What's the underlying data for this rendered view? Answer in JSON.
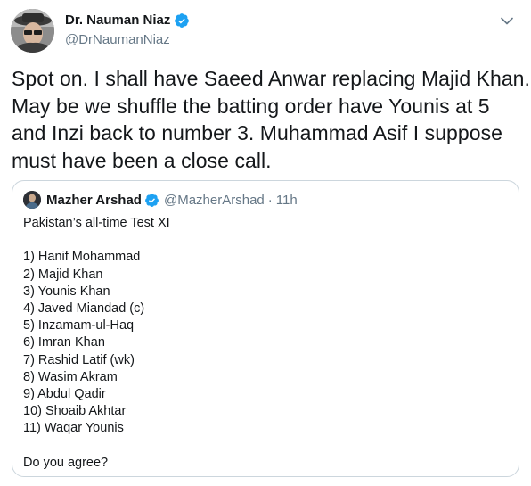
{
  "author": {
    "display_name": "Dr. Nauman Niaz",
    "handle": "@DrNaumanNiaz",
    "verified": true,
    "avatar_icon": "avatar-photo-icon"
  },
  "tweet": {
    "lines": [
      "Spot on. I shall have Saeed Anwar replacing Majid Khan.",
      "May be we shuffle the batting order have Younis at 5",
      "and Inzi back to number 3. Muhammad Asif I suppose",
      "must have been a close call."
    ]
  },
  "quoted": {
    "display_name": "Mazher Arshad",
    "handle": "@MazherArshad",
    "separator": "·",
    "time": "11h",
    "verified": true,
    "intro": "Pakistan’s all-time Test XI",
    "list": [
      "1) Hanif Mohammad",
      "2) Majid Khan",
      "3) Younis Khan",
      "4) Javed Miandad (c)",
      "5) Inzamam-ul-Haq",
      "6) Imran Khan",
      "7) Rashid Latif (wk)",
      "8) Wasim Akram",
      "9) Abdul Qadir",
      "10) Shoaib Akhtar",
      "11) Waqar Younis"
    ],
    "closing": "Do you agree?"
  },
  "colors": {
    "text_primary": "#14171a",
    "text_secondary": "#657786",
    "verified_blue": "#1da1f2",
    "border": "#ccd6dd"
  }
}
